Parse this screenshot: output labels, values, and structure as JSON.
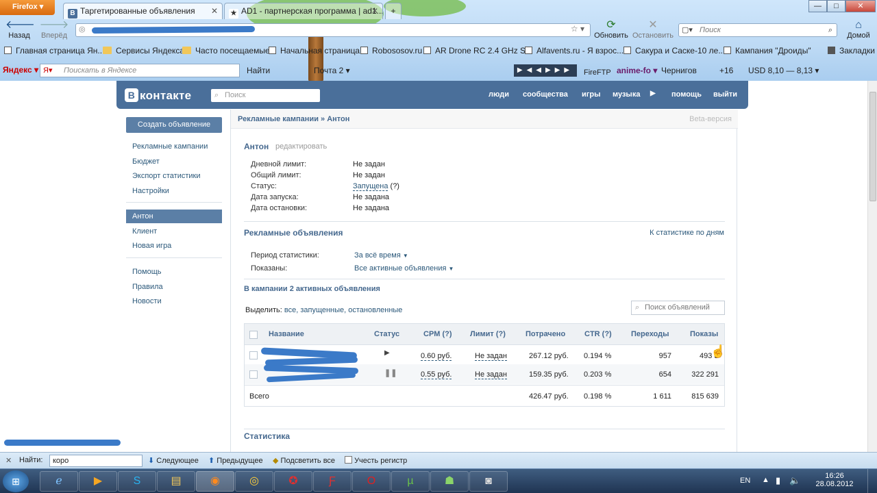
{
  "browser": {
    "menu_label": "Firefox",
    "tabs": [
      {
        "label": "Таргетированные объявления",
        "icon": "B"
      },
      {
        "label": "AD1 - партнерская программа | ad1..."
      }
    ],
    "nav": {
      "back": "Назад",
      "forward": "Вперёд",
      "reload": "Обновить",
      "stop": "Остановить",
      "home": "Домой"
    },
    "search_placeholder": "Поиск",
    "bookmarks": [
      "Главная страница Ян...",
      "Сервисы Яндекса",
      "Часто посещаемые",
      "Начальная страница",
      "Robososov.ru",
      "AR Drone RC 2.4 GHz S...",
      "Alfavents.ru - Я взрос...",
      "Сакура и Саске-10 ле...",
      "Кампания \"Дроиды\"",
      "Закладки"
    ],
    "yandex": {
      "logo": "Яндекс",
      "search_placeholder": "Поискать в Яндексе",
      "find": "Найти",
      "mail": "Почта 2",
      "fireftp": "FireFTP",
      "anime": "anime-fo",
      "city": "Чернигов",
      "temp": "+16",
      "usd": "USD 8,10 — 8,13"
    }
  },
  "vk": {
    "logo": "контакте",
    "logo_letter": "В",
    "search_placeholder": "Поиск",
    "nav": [
      "люди",
      "сообщества",
      "игры",
      "музыка",
      "помощь",
      "выйти"
    ],
    "sidebar": {
      "create_button": "Создать объявление",
      "group1": [
        "Рекламные кампании",
        "Бюджет",
        "Экспорт статистики",
        "Настройки"
      ],
      "selected": "Антон",
      "group2": [
        "Клиент",
        "Новая игра"
      ],
      "group3": [
        "Помощь",
        "Правила",
        "Новости"
      ]
    },
    "breadcrumb": "Рекламные кампании » Антон",
    "beta": "Beta-версия",
    "campaign": {
      "name": "Антон",
      "edit": "редактировать",
      "fields": [
        {
          "label": "Дневной лимит:",
          "value": "Не задан"
        },
        {
          "label": "Общий лимит:",
          "value": "Не задан"
        },
        {
          "label": "Статус:",
          "value": "Запущена",
          "extra": "(?)"
        },
        {
          "label": "Дата запуска:",
          "value": "Не задана"
        },
        {
          "label": "Дата остановки:",
          "value": "Не задана"
        }
      ]
    },
    "ads": {
      "title": "Рекламные объявления",
      "stats_link": "К статистике по дням",
      "period_label": "Период статистики:",
      "period_value": "За всё время",
      "shown_label": "Показаны:",
      "shown_value": "Все активные объявления",
      "count_title": "В кампании 2 активных объявления",
      "select_prefix": "Выделить:",
      "select_options": "все, запущенные, остановленные",
      "search_placeholder": "Поиск объявлений",
      "columns": [
        "Название",
        "Статус",
        "CPM (?)",
        "Лимит (?)",
        "Потрачено",
        "CTR (?)",
        "Переходы",
        "Показы"
      ],
      "rows": [
        {
          "status": "play",
          "cpm": "0.60 руб.",
          "limit": "Не задан",
          "spent": "267.12 руб.",
          "ctr": "0.194 %",
          "clicks": "957",
          "views": "493 3"
        },
        {
          "status": "pause",
          "cpm": "0.55 руб.",
          "limit": "Не задан",
          "spent": "159.35 руб.",
          "ctr": "0.203 %",
          "clicks": "654",
          "views": "322 291"
        }
      ],
      "total": {
        "label": "Всего",
        "spent": "426.47 руб.",
        "ctr": "0.198 %",
        "clicks": "1 611",
        "views": "815 639"
      }
    },
    "stats_title": "Статистика"
  },
  "findbar": {
    "label": "Найти:",
    "value": "коро",
    "next": "Следующее",
    "prev": "Предыдущее",
    "highlight": "Подсветить все",
    "case": "Учесть регистр"
  },
  "taskbar": {
    "lang": "EN",
    "time": "16:26",
    "date": "28.08.2012"
  }
}
